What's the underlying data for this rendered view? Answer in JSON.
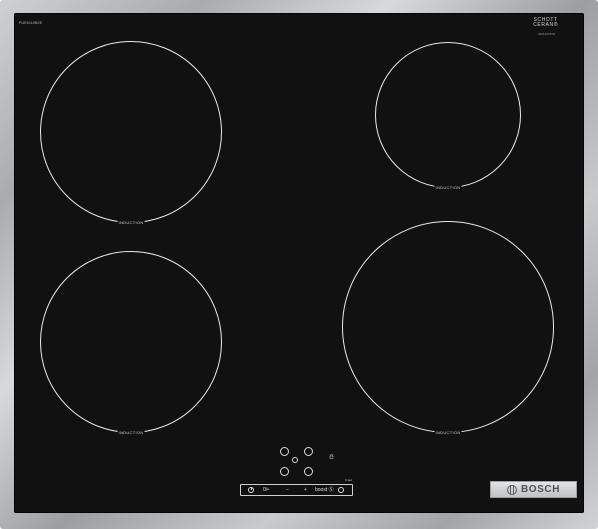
{
  "model_code": "PUE6110B2E",
  "glass_brand": {
    "line1": "SCHOTT",
    "line2": "CERAN®",
    "sub": "INDUCTION"
  },
  "zones": [
    {
      "label": "INDUCTION"
    },
    {
      "label": "INDUCTION"
    },
    {
      "label": "INDUCTION"
    },
    {
      "label": "INDUCTION"
    }
  ],
  "controls": {
    "power_icon": "power-icon",
    "zone_select": "0/•",
    "minus": "−",
    "plus": "+",
    "boost": "boost Ⓢ",
    "timer_icon": "timer-icon",
    "small_label": "3 sec"
  },
  "brand": "BOSCH",
  "colors": {
    "glass": "#111112",
    "frame": "#b7b9bc",
    "lines": "#e9e9e9"
  }
}
